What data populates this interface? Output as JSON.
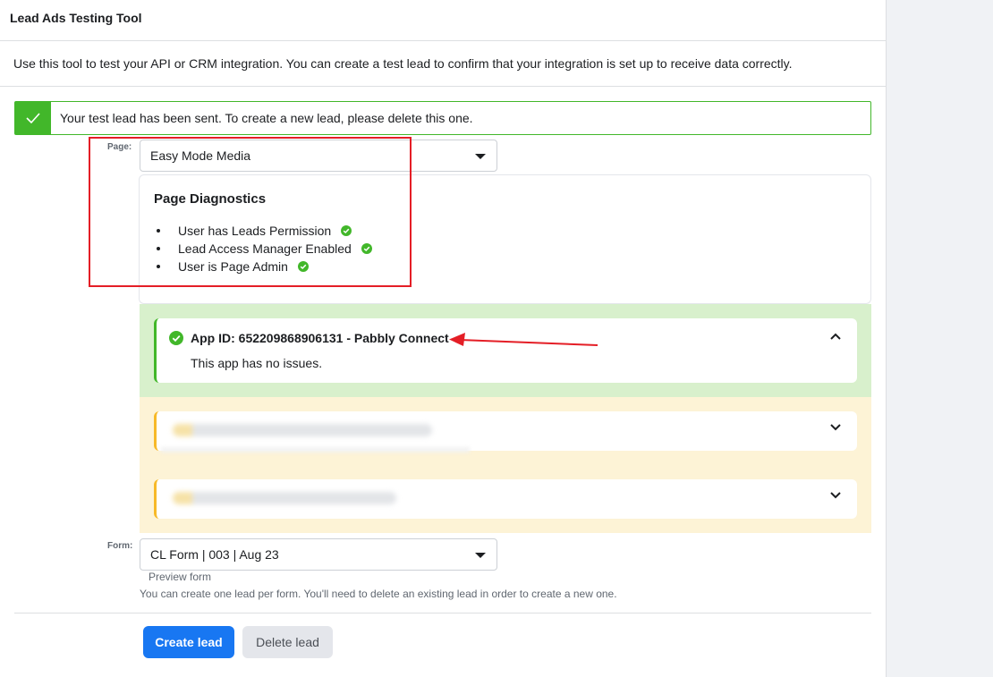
{
  "header": {
    "title": "Lead Ads Testing Tool"
  },
  "intro": "Use this tool to test your API or CRM integration. You can create a test lead to confirm that your integration is set up to receive data correctly.",
  "success": {
    "message": "Your test lead has been sent. To create a new lead, please delete this one."
  },
  "page_field": {
    "label": "Page:",
    "value": "Easy Mode Media"
  },
  "diagnostics": {
    "title": "Page Diagnostics",
    "items": [
      {
        "text": "User has Leads Permission"
      },
      {
        "text": "Lead Access Manager Enabled"
      },
      {
        "text": "User is Page Admin"
      }
    ]
  },
  "apps": {
    "ok_app": {
      "title": "App ID: 652209868906131 - Pabbly Connect",
      "status": "This app has no issues."
    }
  },
  "form_field": {
    "label": "Form:",
    "value": "CL Form | 003 | Aug 23",
    "preview_link": "Preview form"
  },
  "note": "You can create one lead per form. You'll need to delete an existing lead in order to create a new one.",
  "buttons": {
    "create": "Create lead",
    "delete": "Delete lead"
  },
  "colors": {
    "success_green": "#42b72a",
    "primary_blue": "#1877f2",
    "warning_yellow": "#f7b928",
    "annotation_red": "#e41e26"
  }
}
